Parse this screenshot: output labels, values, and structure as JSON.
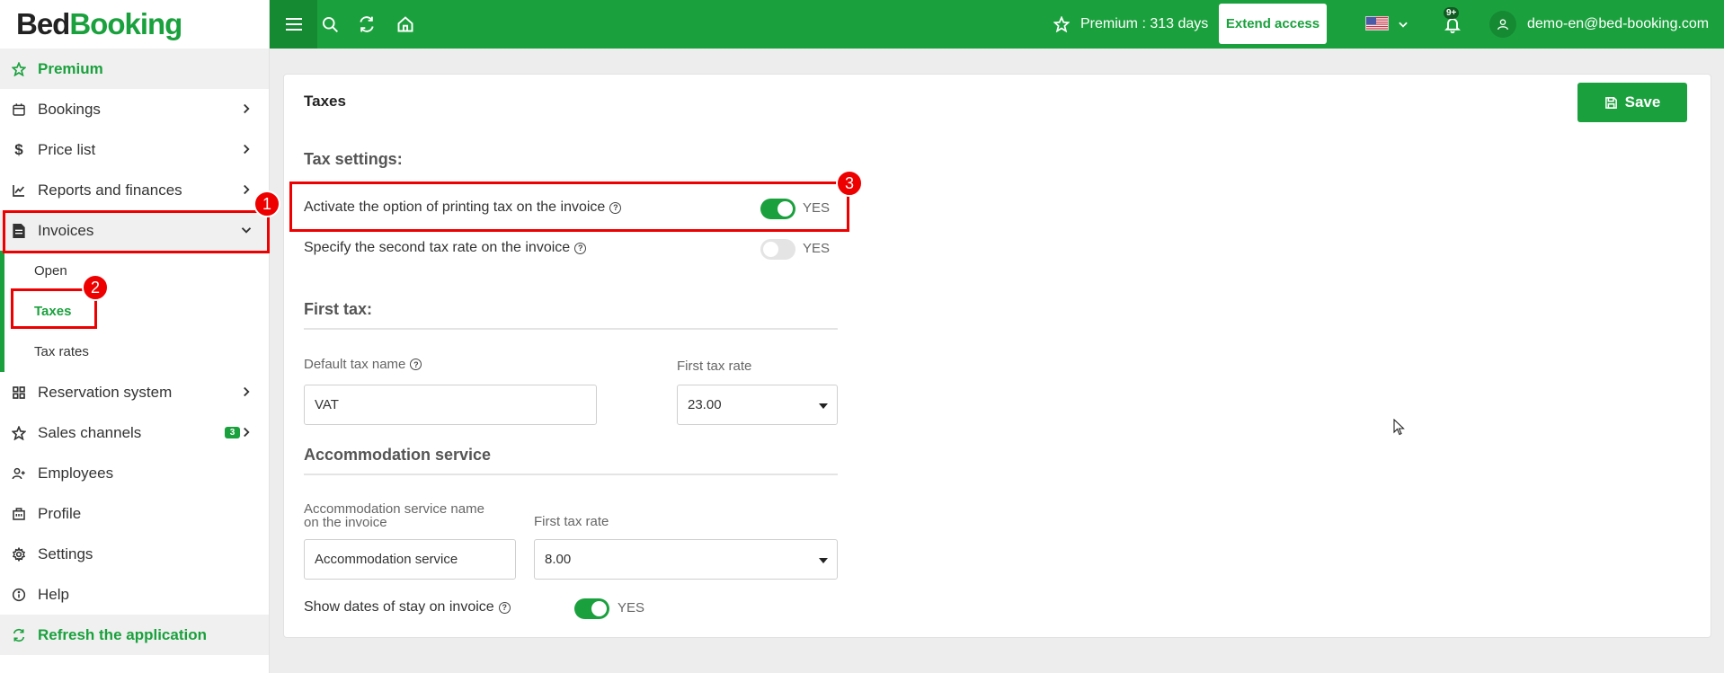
{
  "logo": {
    "part1": "Bed",
    "part2": "Booking"
  },
  "sidebar": {
    "premium": "Premium",
    "bookings": "Bookings",
    "price_list": "Price list",
    "reports": "Reports and finances",
    "invoices": "Invoices",
    "invoices_sub": {
      "open": "Open",
      "taxes": "Taxes",
      "tax_rates": "Tax rates"
    },
    "reservation_system": "Reservation system",
    "sales_channels": "Sales channels",
    "sales_channels_badge": "3",
    "employees": "Employees",
    "profile": "Profile",
    "settings": "Settings",
    "help": "Help",
    "refresh": "Refresh the application"
  },
  "topbar": {
    "premium_info": "Premium : 313 days",
    "extend_access": "Extend access",
    "notifications_badge": "9+",
    "user_email": "demo-en@bed-booking.com"
  },
  "page": {
    "title": "Taxes",
    "save": "Save",
    "tax_settings_heading": "Tax settings:",
    "activate_printing_label": "Activate the option of printing tax on the invoice",
    "activate_printing_value": "YES",
    "second_rate_label": "Specify the second tax rate on the invoice",
    "second_rate_value": "YES",
    "first_tax_heading": "First tax:",
    "default_tax_name_label": "Default tax name",
    "default_tax_name_value": "VAT",
    "first_tax_rate_label": "First tax rate",
    "first_tax_rate_value": "23.00",
    "accommodation_heading": "Accommodation service",
    "accommodation_name_label_line1": "Accommodation service name",
    "accommodation_name_label_line2": "on the invoice",
    "accommodation_name_value": "Accommodation service",
    "accommodation_rate_label": "First tax rate",
    "accommodation_rate_value": "8.00",
    "show_dates_label": "Show dates of stay on invoice",
    "show_dates_value": "YES"
  },
  "annotations": {
    "n1": "1",
    "n2": "2",
    "n3": "3"
  },
  "colors": {
    "brand_green": "#1aa13d",
    "dark_green": "#158a33",
    "annotation_red": "#e00000"
  }
}
